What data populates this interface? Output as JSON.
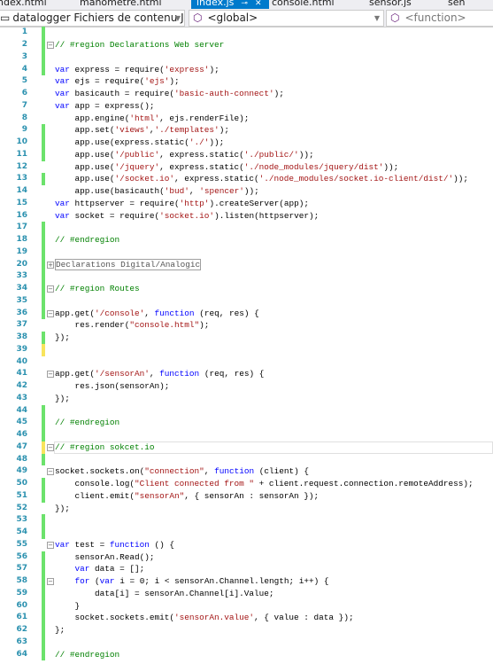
{
  "tabs": [
    {
      "label": "index.html",
      "active": false
    },
    {
      "label": "manometre.html",
      "active": false
    },
    {
      "label": "index.js",
      "active": true
    },
    {
      "label": "console.html",
      "active": false
    },
    {
      "label": "sensor.js",
      "active": false
    },
    {
      "label": "sen",
      "active": false
    }
  ],
  "nav": {
    "project": "datalogger Fichiers de contenu JavaSc",
    "scope": "<global>",
    "member": "<function>"
  },
  "colors": {
    "keyword": "#0000ff",
    "string": "#a31515",
    "comment": "#008000",
    "line_number": "#2b91af",
    "changed_saved": "#6ce26c",
    "changed_unsaved": "#f8e45c",
    "active_tab": "#007acc"
  },
  "lines": [
    {
      "n": "1",
      "m": "g",
      "t": []
    },
    {
      "n": "2",
      "m": "g",
      "f": "-",
      "t": [
        [
          "c",
          "// #region Declarations Web server"
        ]
      ]
    },
    {
      "n": "3",
      "m": "g",
      "t": []
    },
    {
      "n": "4",
      "m": "g",
      "t": [
        [
          "k",
          "var"
        ],
        [
          "p",
          " express = require("
        ],
        [
          "s",
          "'express'"
        ],
        [
          "p",
          ");"
        ]
      ]
    },
    {
      "n": "5",
      "t": [
        [
          "k",
          "var"
        ],
        [
          "p",
          " ejs = require("
        ],
        [
          "s",
          "'ejs'"
        ],
        [
          "p",
          ");"
        ]
      ]
    },
    {
      "n": "6",
      "t": [
        [
          "k",
          "var"
        ],
        [
          "p",
          " basicauth = require("
        ],
        [
          "s",
          "'basic-auth-connect'"
        ],
        [
          "p",
          ");"
        ]
      ]
    },
    {
      "n": "7",
      "t": [
        [
          "k",
          "var"
        ],
        [
          "p",
          " app = express();"
        ]
      ]
    },
    {
      "n": "8",
      "t": [
        [
          "p",
          "    app.engine("
        ],
        [
          "s",
          "'html'"
        ],
        [
          "p",
          ", ejs.renderFile);"
        ]
      ]
    },
    {
      "n": "9",
      "m": "g",
      "t": [
        [
          "p",
          "    app.set("
        ],
        [
          "s",
          "'views'"
        ],
        [
          "p",
          ","
        ],
        [
          "s",
          "'./templates'"
        ],
        [
          "p",
          ");"
        ]
      ]
    },
    {
      "n": "10",
      "m": "g",
      "t": [
        [
          "p",
          "    app.use(express.static("
        ],
        [
          "s",
          "'./'"
        ],
        [
          "p",
          "));"
        ]
      ]
    },
    {
      "n": "11",
      "m": "g",
      "t": [
        [
          "p",
          "    app.use("
        ],
        [
          "s",
          "'/public'"
        ],
        [
          "p",
          ", express.static("
        ],
        [
          "s",
          "'./public/'"
        ],
        [
          "p",
          "));"
        ]
      ]
    },
    {
      "n": "12",
      "t": [
        [
          "p",
          "    app.use("
        ],
        [
          "s",
          "'/jquery'"
        ],
        [
          "p",
          ", express.static("
        ],
        [
          "s",
          "'./node_modules/jquery/dist'"
        ],
        [
          "p",
          "));"
        ]
      ]
    },
    {
      "n": "13",
      "m": "g",
      "t": [
        [
          "p",
          "    app.use("
        ],
        [
          "s",
          "'/socket.io'"
        ],
        [
          "p",
          ", express.static("
        ],
        [
          "s",
          "'./node_modules/socket.io-client/dist/'"
        ],
        [
          "p",
          "));"
        ]
      ]
    },
    {
      "n": "14",
      "t": [
        [
          "p",
          "    app.use(basicauth("
        ],
        [
          "s",
          "'bud'"
        ],
        [
          "p",
          ", "
        ],
        [
          "s",
          "'spencer'"
        ],
        [
          "p",
          "));"
        ]
      ]
    },
    {
      "n": "15",
      "t": [
        [
          "k",
          "var"
        ],
        [
          "p",
          " httpserver = require("
        ],
        [
          "s",
          "'http'"
        ],
        [
          "p",
          ").createServer(app);"
        ]
      ]
    },
    {
      "n": "16",
      "t": [
        [
          "k",
          "var"
        ],
        [
          "p",
          " socket = require("
        ],
        [
          "s",
          "'socket.io'"
        ],
        [
          "p",
          ").listen(httpserver);"
        ]
      ]
    },
    {
      "n": "17",
      "m": "g",
      "t": []
    },
    {
      "n": "18",
      "m": "g",
      "t": [
        [
          "c",
          "// #endregion"
        ]
      ]
    },
    {
      "n": "19",
      "m": "g",
      "t": []
    },
    {
      "n": "20",
      "m": "g",
      "f": "+",
      "boxed": true,
      "t": [
        [
          "b",
          "Declarations Digital/Analogic"
        ]
      ]
    },
    {
      "n": "33",
      "m": "g",
      "t": []
    },
    {
      "n": "34",
      "m": "g",
      "f": "-",
      "t": [
        [
          "c",
          "// #region Routes"
        ]
      ]
    },
    {
      "n": "35",
      "m": "g",
      "t": []
    },
    {
      "n": "36",
      "m": "g",
      "f": "-",
      "t": [
        [
          "p",
          "app.get("
        ],
        [
          "s",
          "'/console'"
        ],
        [
          "p",
          ", "
        ],
        [
          "k",
          "function"
        ],
        [
          "p",
          " (req, res) {"
        ]
      ]
    },
    {
      "n": "37",
      "t": [
        [
          "p",
          "    res.render("
        ],
        [
          "s",
          "\"console.html\""
        ],
        [
          "p",
          ");"
        ]
      ]
    },
    {
      "n": "38",
      "m": "g",
      "t": [
        [
          "p",
          "});"
        ]
      ]
    },
    {
      "n": "39",
      "m": "y",
      "t": []
    },
    {
      "n": "40",
      "t": []
    },
    {
      "n": "41",
      "f": "-",
      "t": [
        [
          "p",
          "app.get("
        ],
        [
          "s",
          "'/sensorAn'"
        ],
        [
          "p",
          ", "
        ],
        [
          "k",
          "function"
        ],
        [
          "p",
          " (req, res) {"
        ]
      ]
    },
    {
      "n": "42",
      "t": [
        [
          "p",
          "    res.json(sensorAn);"
        ]
      ]
    },
    {
      "n": "43",
      "t": [
        [
          "p",
          "});"
        ]
      ]
    },
    {
      "n": "44",
      "m": "g",
      "t": []
    },
    {
      "n": "45",
      "m": "g",
      "t": [
        [
          "c",
          "// #endregion"
        ]
      ]
    },
    {
      "n": "46",
      "m": "g",
      "t": []
    },
    {
      "n": "47",
      "m": "y",
      "f": "-",
      "cur": true,
      "t": [
        [
          "c",
          "// #region sokcet.io"
        ]
      ]
    },
    {
      "n": "48",
      "m": "g",
      "t": []
    },
    {
      "n": "49",
      "f": "-",
      "t": [
        [
          "p",
          "socket.sockets.on("
        ],
        [
          "s",
          "\"connection\""
        ],
        [
          "p",
          ", "
        ],
        [
          "k",
          "function"
        ],
        [
          "p",
          " (client) {"
        ]
      ]
    },
    {
      "n": "50",
      "m": "g",
      "t": [
        [
          "p",
          "    console.log("
        ],
        [
          "s",
          "\"Client connected from \""
        ],
        [
          "p",
          " + client.request.connection.remoteAddress);"
        ]
      ]
    },
    {
      "n": "51",
      "m": "g",
      "t": [
        [
          "p",
          "    client.emit("
        ],
        [
          "s",
          "\"sensorAn\""
        ],
        [
          "p",
          ", { sensorAn : sensorAn });"
        ]
      ]
    },
    {
      "n": "52",
      "t": [
        [
          "p",
          "});"
        ]
      ]
    },
    {
      "n": "53",
      "m": "g",
      "t": []
    },
    {
      "n": "54",
      "m": "g",
      "t": []
    },
    {
      "n": "55",
      "f": "-",
      "t": [
        [
          "k",
          "var"
        ],
        [
          "p",
          " test = "
        ],
        [
          "k",
          "function"
        ],
        [
          "p",
          " () {"
        ]
      ]
    },
    {
      "n": "56",
      "m": "g",
      "t": [
        [
          "p",
          "    sensorAn.Read();"
        ]
      ]
    },
    {
      "n": "57",
      "m": "g",
      "t": [
        [
          "p",
          "    "
        ],
        [
          "k",
          "var"
        ],
        [
          "p",
          " data = [];"
        ]
      ]
    },
    {
      "n": "58",
      "m": "g",
      "f": "-",
      "t": [
        [
          "p",
          "    "
        ],
        [
          "k",
          "for"
        ],
        [
          "p",
          " ("
        ],
        [
          "k",
          "var"
        ],
        [
          "p",
          " i = 0; i < sensorAn.Channel.length; i++) {"
        ]
      ]
    },
    {
      "n": "59",
      "m": "g",
      "t": [
        [
          "p",
          "        data[i] = sensorAn.Channel[i].Value;"
        ]
      ]
    },
    {
      "n": "60",
      "m": "g",
      "t": [
        [
          "p",
          "    }"
        ]
      ]
    },
    {
      "n": "61",
      "m": "g",
      "t": [
        [
          "p",
          "    socket.sockets.emit("
        ],
        [
          "s",
          "'sensorAn.value'"
        ],
        [
          "p",
          ", { value : data });"
        ]
      ]
    },
    {
      "n": "62",
      "m": "g",
      "t": [
        [
          "p",
          "};"
        ]
      ]
    },
    {
      "n": "63",
      "m": "g",
      "t": []
    },
    {
      "n": "64",
      "m": "g",
      "t": [
        [
          "c",
          "// #endregion"
        ]
      ]
    }
  ]
}
